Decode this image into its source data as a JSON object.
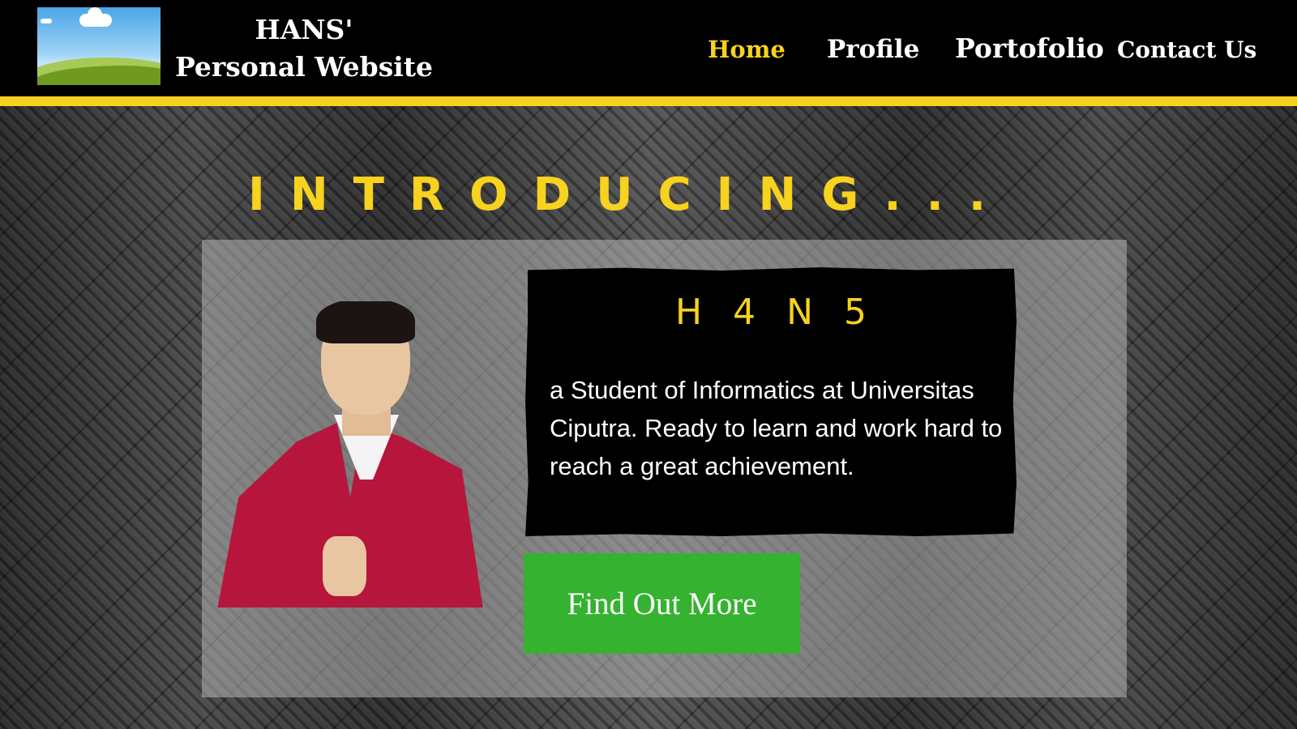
{
  "header": {
    "site_title_line1": "HANS'",
    "site_title_line2": "Personal Website",
    "logo_icon": "landscape-image-icon",
    "nav": {
      "home": "Home",
      "profile": "Profile",
      "portfolio": "Portofolio",
      "contact": "Contact Us"
    },
    "active_nav": "Home"
  },
  "hero": {
    "heading": "INTRODUCING...",
    "card_title": "H4N5",
    "description": "a Student of Informatics at Universitas Ciputra. Ready to learn and work hard to reach a great achievement.",
    "button_label": "Find Out More"
  },
  "colors": {
    "accent": "#f7d21e",
    "button": "#35b22f",
    "header_bg": "#000000",
    "jacket": "#b6163b"
  }
}
